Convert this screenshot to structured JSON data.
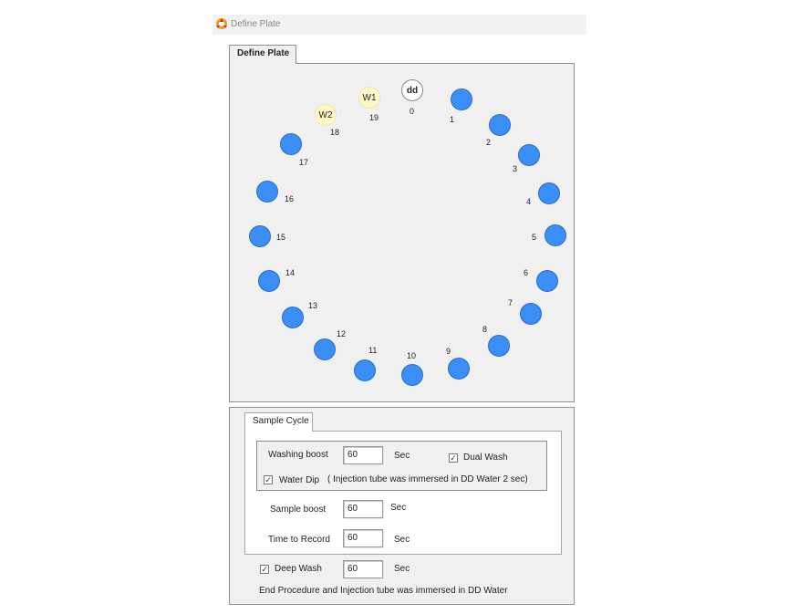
{
  "window": {
    "title": "Define Plate"
  },
  "plate_tab": {
    "label": "Define Plate"
  },
  "plate": {
    "dd": {
      "text": "dd",
      "number": "0"
    },
    "w1": {
      "text": "W1",
      "number": "19"
    },
    "w2": {
      "text": "W2",
      "number": "18"
    },
    "wells": [
      "1",
      "2",
      "3",
      "4",
      "5",
      "6",
      "7",
      "8",
      "9",
      "10",
      "11",
      "12",
      "13",
      "14",
      "15",
      "16",
      "17"
    ]
  },
  "sample_cycle": {
    "tab_label": "Sample Cycle",
    "washing_boost": {
      "label": "Washing boost",
      "value": "60",
      "unit": "Sec"
    },
    "dual_wash": {
      "label": "Dual Wash",
      "checked": true
    },
    "water_dip": {
      "label": "Water Dip",
      "checked": true,
      "note": "( Injection tube was immersed in DD Water 2 sec)"
    },
    "sample_boost": {
      "label": "Sample boost",
      "value": "60",
      "unit": "Sec"
    },
    "time_to_record": {
      "label": "Time  to Record",
      "value": "60",
      "unit": "Sec"
    }
  },
  "deep_wash": {
    "label": "Deep Wash",
    "checked": true,
    "value": "60",
    "unit": "Sec"
  },
  "end_procedure": {
    "text": "End Procedure and Injection tube was immersed in DD Water"
  },
  "colors": {
    "well_blue": "#3a8ef5",
    "wash_yellow": "#fff8c4",
    "panel_gray": "#f0f0f0"
  }
}
